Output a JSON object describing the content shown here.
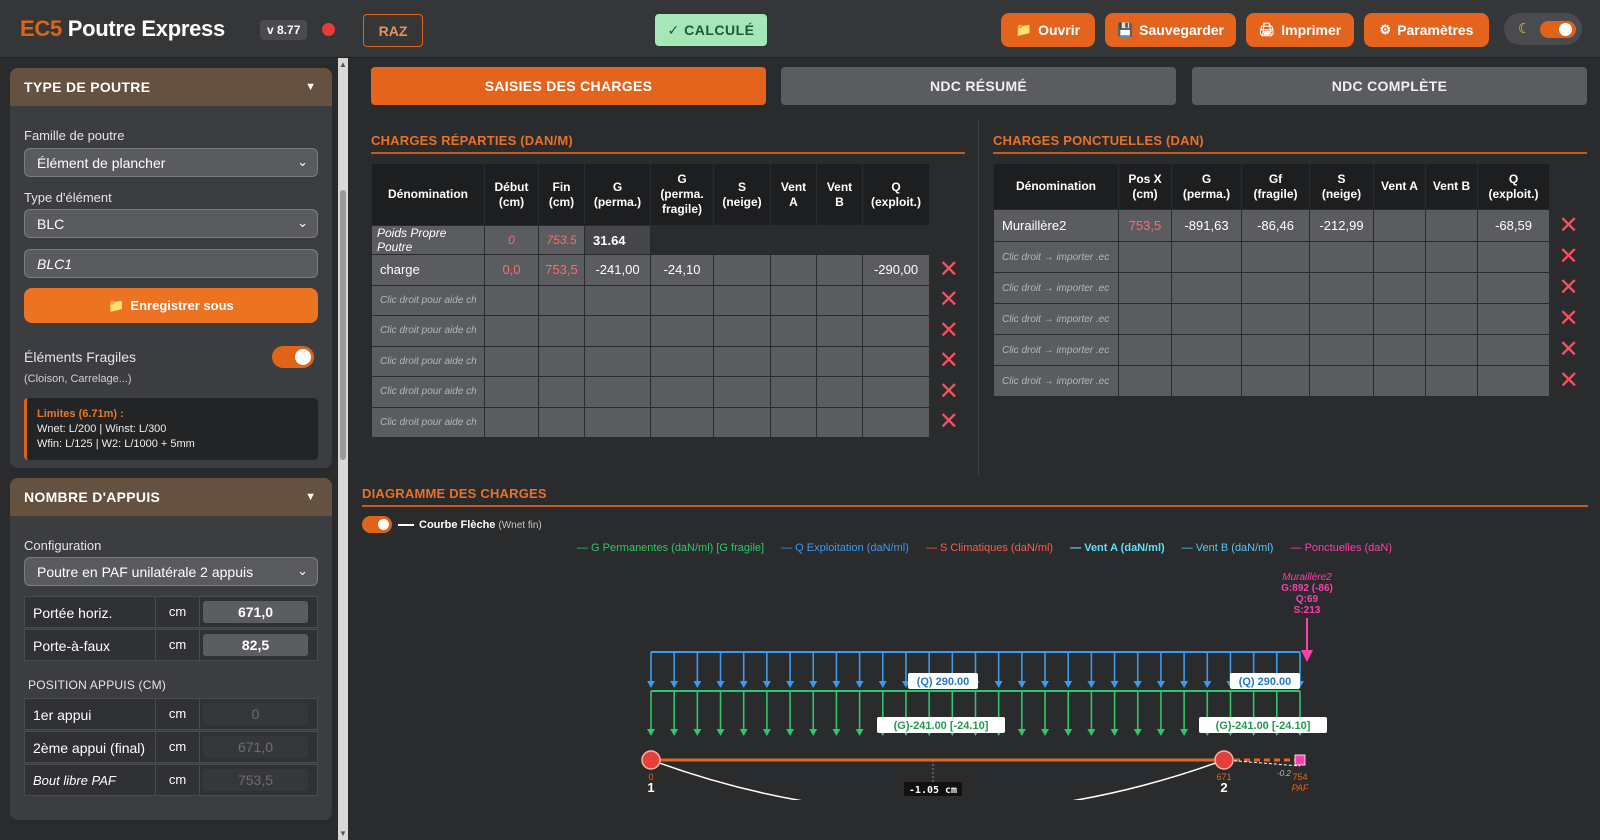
{
  "header": {
    "brand_accent": "EC5",
    "brand_name": "Poutre Express",
    "version": "v 8.77",
    "raz": "RAZ",
    "calc_status": "✓ CALCULÉ",
    "buttons": {
      "open": "Ouvrir",
      "save": "Sauvegarder",
      "print": "Imprimer",
      "settings": "Paramètres"
    }
  },
  "sidebar": {
    "beam_type": {
      "title": "TYPE DE POUTRE",
      "family_label": "Famille de poutre",
      "family_value": "Élément de plancher",
      "element_type_label": "Type d'élément",
      "element_type_value": "BLC",
      "name_value": "BLC1",
      "save_as": "Enregistrer sous",
      "fragile_label": "Éléments Fragiles",
      "fragile_sub": "(Cloison, Carrelage...)",
      "limits_title": "Limites (6.71m) :",
      "limits_line1": "Wnet: L/200 | Winst: L/300",
      "limits_line2": "Wfin: L/125 | W2: L/1000 + 5mm"
    },
    "supports": {
      "title": "NOMBRE D'APPUIS",
      "config_label": "Configuration",
      "config_value": "Poutre en PAF unilatérale 2 appuis",
      "span_label": "Portée horiz.",
      "span_unit": "cm",
      "span_value": "671,0",
      "overhang_label": "Porte-à-faux",
      "overhang_unit": "cm",
      "overhang_value": "82,5",
      "positions_title": "POSITION APPUIS (CM)",
      "support1_label": "1er appui",
      "support1_unit": "cm",
      "support1_value": "0",
      "support2_label": "2ème appui (final)",
      "support2_unit": "cm",
      "support2_value": "671,0",
      "free_end_label": "Bout libre PAF",
      "free_end_unit": "cm",
      "free_end_value": "753,5"
    }
  },
  "tabs": [
    "SAISIES DES CHARGES",
    "NDC RÉSUMÉ",
    "NDC COMPLÈTE"
  ],
  "distributed": {
    "title": "CHARGES RÉPARTIES (DAN/M)",
    "headers": {
      "name": "Dénomination",
      "start_1": "Début",
      "start_2": "(cm)",
      "end_1": "Fin",
      "end_2": "(cm)",
      "g_1": "G",
      "g_2": "(perma.)",
      "gf_1": "G",
      "gf_2": "(perma.",
      "gf_3": "fragile)",
      "s_1": "S",
      "s_2": "(neige)",
      "va_1": "Vent",
      "va_2": "A",
      "vb_1": "Vent",
      "vb_2": "B",
      "q_1": "Q",
      "q_2": "(exploit.)"
    },
    "self_weight": {
      "name": "Poids Propre Poutre",
      "start": "0",
      "end": "753.5",
      "g": "31.64"
    },
    "rows": [
      {
        "name": "charge",
        "start": "0,0",
        "end": "753,5",
        "g": "-241,00",
        "gf": "-24,10",
        "s": "",
        "va": "",
        "vb": "",
        "q": "-290,00",
        "hint": false
      },
      {
        "name": "Clic droit pour aide ch",
        "start": "",
        "end": "",
        "g": "",
        "gf": "",
        "s": "",
        "va": "",
        "vb": "",
        "q": "",
        "hint": true
      },
      {
        "name": "Clic droit pour aide ch",
        "start": "",
        "end": "",
        "g": "",
        "gf": "",
        "s": "",
        "va": "",
        "vb": "",
        "q": "",
        "hint": true
      },
      {
        "name": "Clic droit pour aide ch",
        "start": "",
        "end": "",
        "g": "",
        "gf": "",
        "s": "",
        "va": "",
        "vb": "",
        "q": "",
        "hint": true
      },
      {
        "name": "Clic droit pour aide ch",
        "start": "",
        "end": "",
        "g": "",
        "gf": "",
        "s": "",
        "va": "",
        "vb": "",
        "q": "",
        "hint": true
      },
      {
        "name": "Clic droit pour aide ch",
        "start": "",
        "end": "",
        "g": "",
        "gf": "",
        "s": "",
        "va": "",
        "vb": "",
        "q": "",
        "hint": true
      }
    ],
    "delete_glyph": "✕"
  },
  "point": {
    "title": "CHARGES PONCTUELLES (DAN)",
    "headers": {
      "name": "Dénomination",
      "pos_1": "Pos X",
      "pos_2": "(cm)",
      "g_1": "G",
      "g_2": "(perma.)",
      "gf_1": "Gf",
      "gf_2": "(fragile)",
      "s_1": "S",
      "s_2": "(neige)",
      "va": "Vent A",
      "vb": "Vent B",
      "q_1": "Q",
      "q_2": "(exploit.)"
    },
    "rows": [
      {
        "name": "Muraillère2",
        "pos": "753,5",
        "g": "-891,63",
        "gf": "-86,46",
        "s": "-212,99",
        "va": "",
        "vb": "",
        "q": "-68,59",
        "hint": false
      },
      {
        "name": "Clic droit → importer .ec",
        "pos": "",
        "g": "",
        "gf": "",
        "s": "",
        "va": "",
        "vb": "",
        "q": "",
        "hint": true
      },
      {
        "name": "Clic droit → importer .ec",
        "pos": "",
        "g": "",
        "gf": "",
        "s": "",
        "va": "",
        "vb": "",
        "q": "",
        "hint": true
      },
      {
        "name": "Clic droit → importer .ec",
        "pos": "",
        "g": "",
        "gf": "",
        "s": "",
        "va": "",
        "vb": "",
        "q": "",
        "hint": true
      },
      {
        "name": "Clic droit → importer .ec",
        "pos": "",
        "g": "",
        "gf": "",
        "s": "",
        "va": "",
        "vb": "",
        "q": "",
        "hint": true
      },
      {
        "name": "Clic droit → importer .ec",
        "pos": "",
        "g": "",
        "gf": "",
        "s": "",
        "va": "",
        "vb": "",
        "q": "",
        "hint": true
      }
    ]
  },
  "diagram": {
    "title": "DIAGRAMME DES CHARGES",
    "curve_label": "Courbe Flèche",
    "curve_sub": "(Wnet fin)",
    "legend": {
      "g": "— G Permanentes (daN/ml) [G fragile]",
      "q": "— Q Exploitation (daN/ml)",
      "s": "— S Climatiques (daN/ml)",
      "va": "— Vent A (daN/ml)",
      "vb": "— Vent B (daN/ml)",
      "p": "— Ponctuelles (daN)"
    },
    "q_label": "(Q) 290.00",
    "g_label": "(G)-241.00 [-24.10]",
    "point_name": "Muraillère2",
    "point_g": "G:892 (-86)",
    "point_q": "Q:69",
    "point_s": "S:213",
    "deflection": "-1.05 cm",
    "support1_pos": "0",
    "support1_num": "1",
    "support2_pos": "671",
    "support2_num": "2",
    "end_defl": "-0.2",
    "end_pos": "754",
    "paf": "PAF",
    "beam_length_cm": 753.5,
    "support_positions_cm": [
      0,
      671
    ],
    "colors": {
      "g": "#2fc76a",
      "q": "#3b9af0",
      "s": "#ff5a4a",
      "va": "#5fe1f5",
      "vb": "#59c7f0",
      "p": "#ff3fae",
      "beam": "#e8641b",
      "accent": "#e06418"
    }
  }
}
